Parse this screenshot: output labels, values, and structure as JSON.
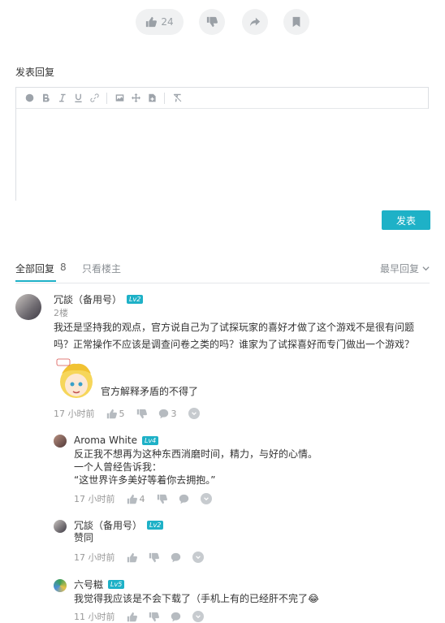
{
  "top_actions": {
    "like_count": "24"
  },
  "reply_box": {
    "title": "发表回复",
    "submit_label": "发表"
  },
  "tabs": {
    "all_label": "全部回复",
    "all_count": "8",
    "op_only_label": "只看楼主",
    "sort_label": "最早回复"
  },
  "comments": [
    {
      "user": "冗談（备用号）",
      "level": "Lv2",
      "floor": "2楼",
      "lines": [
        "我还是坚持我的观点，官方说自己为了试探玩家的喜好才做了这个游戏不是很有问题",
        "吗？正常操作不应该是调查问卷之类的吗？谁家为了试探喜好而专门做出一个游戏？"
      ],
      "sticker_caption": "官方解释矛盾的不得了",
      "time": "17 小时前",
      "likes": "5",
      "replies": "3"
    }
  ],
  "sub_replies": [
    {
      "user": "Aroma White",
      "level": "Lv4",
      "lines": [
        "反正我不想再为这种东西消磨时间，精力，与好的心情。",
        "一个人曾经告诉我：",
        "“这世界许多美好等着你去拥抱。”"
      ],
      "time": "17 小时前",
      "likes": "4"
    },
    {
      "user": "冗談（备用号）",
      "level": "Lv2",
      "lines": [
        "赞同"
      ],
      "time": "17 小时前",
      "likes": ""
    },
    {
      "user": "六号糍",
      "level": "Lv5",
      "lines": [
        "我觉得我应该是不会下载了（手机上有的已经肝不完了😂"
      ],
      "time": "11 小时前",
      "likes": ""
    }
  ],
  "colors": {
    "accent": "#1eb1c7",
    "pill_bg": "#f0f1f2"
  }
}
